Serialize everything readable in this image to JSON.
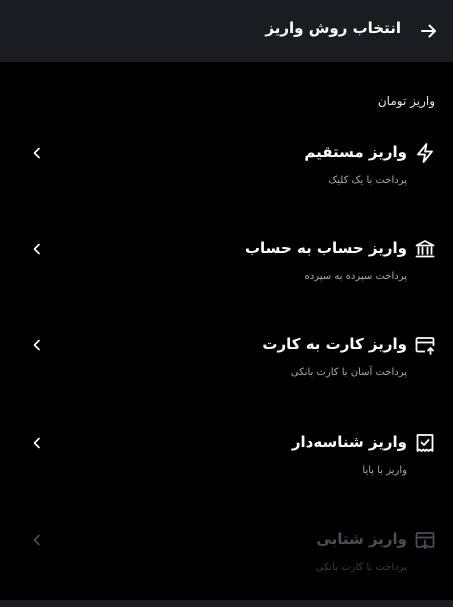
{
  "header": {
    "title": "انتخاب روش واریز",
    "back_icon": "arrow-right-icon"
  },
  "section": {
    "title": "واریز تومان"
  },
  "methods": [
    {
      "title": "واریز مستقیم",
      "subtitle": "پرداخت با یک کلیک",
      "icon": "lightning-icon",
      "enabled": true
    },
    {
      "title": "واریز حساب به حساب",
      "subtitle": "پرداخت سپرده به سپرده",
      "icon": "bank-icon",
      "enabled": true
    },
    {
      "title": "واریز کارت به کارت",
      "subtitle": "پرداخت آسان با کارت بانکی",
      "icon": "card-transfer-icon",
      "enabled": true
    },
    {
      "title": "واریز شناسه‌دار",
      "subtitle": "واریز با پایا",
      "icon": "receipt-check-icon",
      "enabled": true
    },
    {
      "title": "واریز شتابی",
      "subtitle": "پرداخت با کارت بانکی",
      "icon": "card-download-icon",
      "enabled": false
    }
  ],
  "colors": {
    "background": "#000000",
    "header": "#1b1c1f",
    "text": "#ffffff",
    "subtext": "#a9a9ad",
    "disabled": "#4d4e52"
  }
}
